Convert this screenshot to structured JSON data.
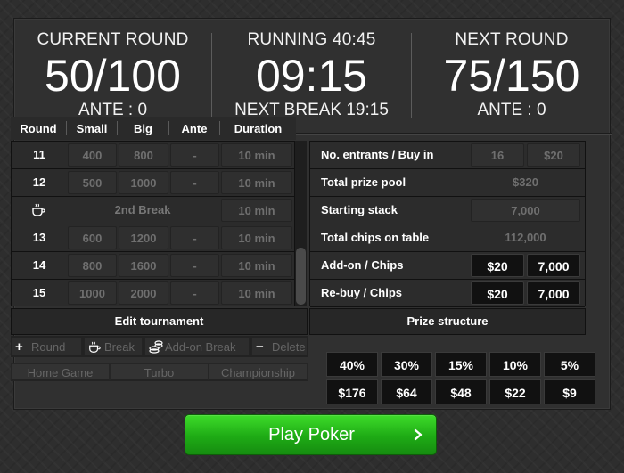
{
  "header": {
    "current": {
      "label": "CURRENT ROUND",
      "blinds": "50/100",
      "ante": "ANTE : 0"
    },
    "running": {
      "label": "RUNNING 40:45",
      "clock": "09:15",
      "next_break": "NEXT BREAK 19:15"
    },
    "next": {
      "label": "NEXT ROUND",
      "blinds": "75/150",
      "ante": "ANTE : 0"
    }
  },
  "rounds": {
    "columns": [
      "Round",
      "Small",
      "Big",
      "Ante",
      "Duration"
    ],
    "rows": [
      {
        "round": "11",
        "small": "400",
        "big": "800",
        "ante": "-",
        "duration": "10 min"
      },
      {
        "round": "12",
        "small": "500",
        "big": "1000",
        "ante": "-",
        "duration": "10 min"
      },
      {
        "break_label": "2nd Break",
        "duration": "10 min",
        "icon": "coffee-cup-icon"
      },
      {
        "round": "13",
        "small": "600",
        "big": "1200",
        "ante": "-",
        "duration": "10 min"
      },
      {
        "round": "14",
        "small": "800",
        "big": "1600",
        "ante": "-",
        "duration": "10 min"
      },
      {
        "round": "15",
        "small": "1000",
        "big": "2000",
        "ante": "-",
        "duration": "10 min"
      }
    ]
  },
  "info": {
    "entrants": {
      "label": "No. entrants / Buy in",
      "entrants": "16",
      "buyin": "$20"
    },
    "prize_pool": {
      "label": "Total prize pool",
      "value": "$320"
    },
    "starting_stack": {
      "label": "Starting stack",
      "value": "7,000"
    },
    "chips_on_table": {
      "label": "Total chips on table",
      "value": "112,000"
    },
    "addon": {
      "label": "Add-on / Chips",
      "price": "$20",
      "chips": "7,000"
    },
    "rebuy": {
      "label": "Re-buy / Chips",
      "price": "$20",
      "chips": "7,000"
    }
  },
  "edit": {
    "title": "Edit tournament",
    "tools": [
      {
        "icon": "+",
        "label": "Round"
      },
      {
        "icon": "cup",
        "label": "Break"
      },
      {
        "icon": "chips",
        "label": "Add-on Break"
      },
      {
        "icon": "−",
        "label": "Delete"
      }
    ],
    "presets": [
      "Home Game",
      "Turbo",
      "Championship"
    ]
  },
  "prize": {
    "title": "Prize structure",
    "percents": [
      "40%",
      "30%",
      "15%",
      "10%",
      "5%"
    ],
    "amounts": [
      "$176",
      "$64",
      "$48",
      "$22",
      "$9"
    ]
  },
  "play_button": {
    "label": "Play Poker"
  },
  "colors": {
    "accent_green": "#1eab15",
    "background": "#2e2e2e"
  }
}
